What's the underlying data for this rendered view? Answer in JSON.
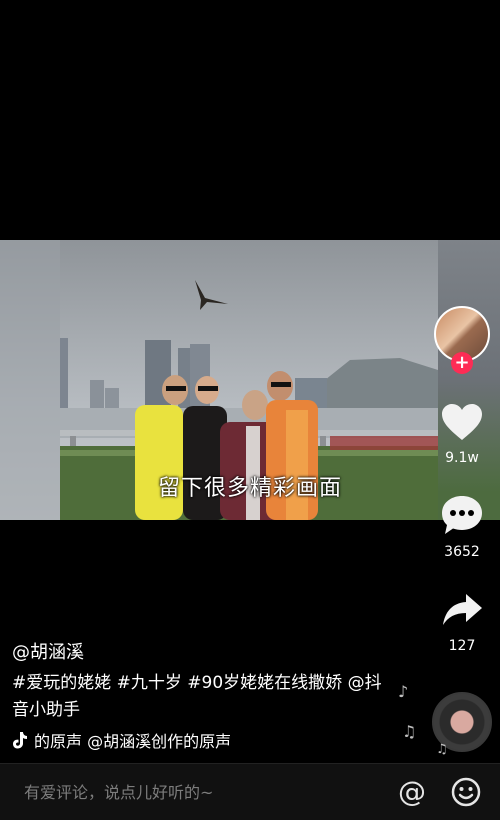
{
  "video": {
    "caption": "留下很多精彩画面"
  },
  "creator": {
    "follow_symbol": "+"
  },
  "actions": {
    "like_count": "9.1w",
    "comment_count": "3652",
    "share_count": "127"
  },
  "post": {
    "author": "@胡涵溪",
    "description": "#爱玩的姥姥 #九十岁 #90岁姥姥在线撒娇 @抖音小助手",
    "music": "的原声    @胡涵溪创作的原声"
  },
  "comment_bar": {
    "placeholder": "有爱评论，说点儿好听的~",
    "at_symbol": "@"
  }
}
